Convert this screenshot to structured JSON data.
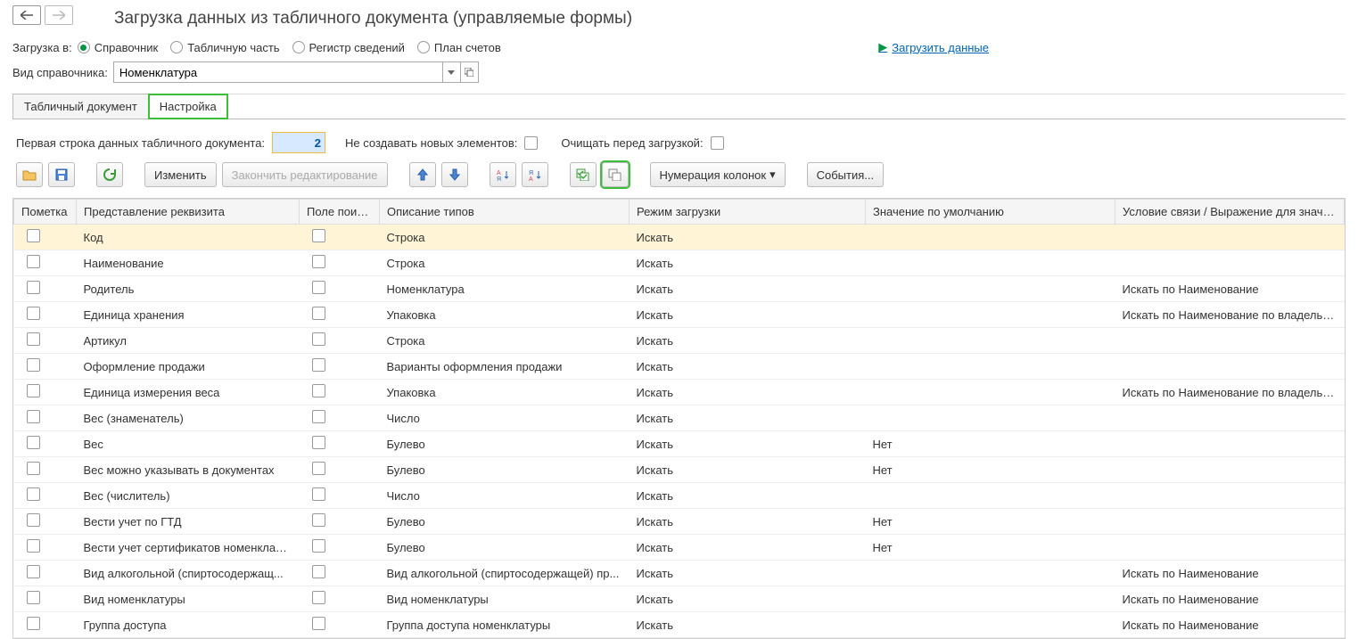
{
  "title": "Загрузка данных из табличного документа (управляемые формы)",
  "load_label": "Загрузка в:",
  "radios": {
    "r1": "Справочник",
    "r2": "Табличную часть",
    "r3": "Регистр сведений",
    "r4": "План счетов"
  },
  "load_link": "Загрузить данные",
  "dict_label": "Вид справочника:",
  "dict_value": "Номенклатура",
  "tabs": {
    "t1": "Табличный документ",
    "t2": "Настройка"
  },
  "first_row_label": "Первая строка данных табличного документа:",
  "first_row_value": "2",
  "no_new_label": "Не создавать новых элементов:",
  "clear_label": "Очищать перед загрузкой:",
  "toolbar": {
    "edit": "Изменить",
    "finish": "Закончить редактирование",
    "numbering": "Нумерация колонок",
    "events": "События..."
  },
  "columns": {
    "mark": "Пометка",
    "repr": "Представление реквизита",
    "search": "Поле поиска",
    "type": "Описание типов",
    "mode": "Режим загрузки",
    "default": "Значение по умолчанию",
    "cond": "Условие связи / Выражение для значения"
  },
  "rows": [
    {
      "repr": "Код",
      "type": "Строка",
      "mode": "Искать",
      "def": "",
      "cond": "",
      "sel": true
    },
    {
      "repr": "Наименование",
      "type": "Строка",
      "mode": "Искать",
      "def": "",
      "cond": ""
    },
    {
      "repr": "Родитель",
      "type": "Номенклатура",
      "mode": "Искать",
      "def": "",
      "cond": "Искать по Наименование"
    },
    {
      "repr": "Единица хранения",
      "type": "Упаковка",
      "mode": "Искать",
      "def": "",
      "cond": "Искать по Наименование по владельцу <С"
    },
    {
      "repr": "Артикул",
      "type": "Строка",
      "mode": "Искать",
      "def": "",
      "cond": ""
    },
    {
      "repr": "Оформление продажи",
      "type": "Варианты оформления продажи",
      "mode": "Искать",
      "def": "",
      "cond": ""
    },
    {
      "repr": "Единица измерения веса",
      "type": "Упаковка",
      "mode": "Искать",
      "def": "",
      "cond": "Искать по Наименование по владельцу <С"
    },
    {
      "repr": "Вес (знаменатель)",
      "type": "Число",
      "mode": "Искать",
      "def": "",
      "cond": ""
    },
    {
      "repr": "Вес",
      "type": "Булево",
      "mode": "Искать",
      "def": "Нет",
      "cond": ""
    },
    {
      "repr": "Вес можно указывать в документах",
      "type": "Булево",
      "mode": "Искать",
      "def": "Нет",
      "cond": ""
    },
    {
      "repr": "Вес (числитель)",
      "type": "Число",
      "mode": "Искать",
      "def": "",
      "cond": ""
    },
    {
      "repr": "Вести учет по ГТД",
      "type": "Булево",
      "mode": "Искать",
      "def": "Нет",
      "cond": ""
    },
    {
      "repr": "Вести учет сертификатов номенклату...",
      "type": "Булево",
      "mode": "Искать",
      "def": "Нет",
      "cond": ""
    },
    {
      "repr": "Вид алкогольной (спиртосодержащ...",
      "type": "Вид алкогольной (спиртосодержащей) пр...",
      "mode": "Искать",
      "def": "",
      "cond": "Искать по Наименование"
    },
    {
      "repr": "Вид номенклатуры",
      "type": "Вид номенклатуры",
      "mode": "Искать",
      "def": "",
      "cond": "Искать по Наименование"
    },
    {
      "repr": "Группа доступа",
      "type": "Группа доступа номенклатуры",
      "mode": "Искать",
      "def": "",
      "cond": "Искать по Наименование"
    }
  ]
}
